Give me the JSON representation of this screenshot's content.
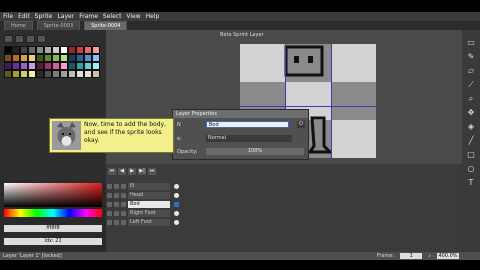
{
  "menu": [
    "File",
    "Edit",
    "Sprite",
    "Layer",
    "Frame",
    "Select",
    "View",
    "Help"
  ],
  "tabs": [
    {
      "label": "Home",
      "active": false
    },
    {
      "label": "Sprite-0003",
      "active": false
    },
    {
      "label": "Sprite-0004",
      "active": true
    }
  ],
  "canvas_title": "Beta Sprint Layer",
  "dialog": {
    "title": "Layer Properties",
    "name_label": "N",
    "name_value": "Bod",
    "side_button": "O",
    "mode_label": "e:",
    "mode_value": "Normal",
    "opacity_label": "Opacity:",
    "opacity_value": "100%"
  },
  "tip": {
    "text": "Now, time to add the body, and see if the sprite looks okay."
  },
  "timeline": {
    "controls": [
      "⏮",
      "◀",
      "▶",
      "▶|",
      "⏭"
    ],
    "layers": [
      {
        "name": "Ei",
        "row": 0
      },
      {
        "name": "Head",
        "row": 1
      },
      {
        "name": "Bod",
        "row": 2
      },
      {
        "name": "Right Foot",
        "row": 3
      },
      {
        "name": "Left Foot",
        "row": 4
      }
    ]
  },
  "color": {
    "hex_value": "fff8f8",
    "index_value": "Idx: 21"
  },
  "status": {
    "left": "Layer 'Layer 1' [locked]",
    "frame_label": "Frame:",
    "frame_value": "1",
    "zoom": "400.0%"
  },
  "icons": {
    "tools": [
      "selection-icon",
      "pencil-icon",
      "eraser-icon",
      "eyedropper-icon",
      "zoom-icon",
      "move-icon",
      "fill-icon",
      "line-icon",
      "rect-icon",
      "ellipse-icon",
      "text-icon"
    ]
  },
  "colors": {
    "tip_bg": "#f3f08b",
    "dialog_bg": "#505050",
    "accent": "#3a6bc4"
  }
}
